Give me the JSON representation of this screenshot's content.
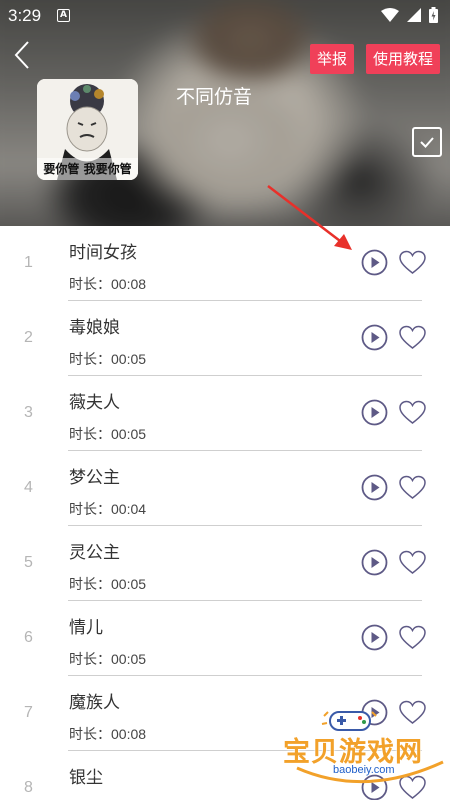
{
  "status_bar": {
    "time": "3:29",
    "notification_badge": "A"
  },
  "header": {
    "report_label": "举报",
    "tutorial_label": "使用教程",
    "album_title": "不同仿音",
    "cover_caption": "要你管 我要你管",
    "back_icon": "chevron-left-icon",
    "select_icon": "checkbox-icon"
  },
  "tracks": [
    {
      "index": "1",
      "name": "时间女孩",
      "duration": "时长：00:08"
    },
    {
      "index": "2",
      "name": "毒娘娘",
      "duration": "时长：00:05"
    },
    {
      "index": "3",
      "name": "薇夫人",
      "duration": "时长：00:05"
    },
    {
      "index": "4",
      "name": "梦公主",
      "duration": "时长：00:04"
    },
    {
      "index": "5",
      "name": "灵公主",
      "duration": "时长：00:05"
    },
    {
      "index": "6",
      "name": "情儿",
      "duration": "时长：00:05"
    },
    {
      "index": "7",
      "name": "魔族人",
      "duration": "时长：00:08"
    },
    {
      "index": "8",
      "name": "银尘",
      "duration": ""
    }
  ],
  "watermark": {
    "text": "宝贝游戏网",
    "url": "baobeiy.com"
  },
  "colors": {
    "accent": "#f04059",
    "icon_purple": "#5e5a86",
    "annotation_arrow": "#e8302a"
  }
}
